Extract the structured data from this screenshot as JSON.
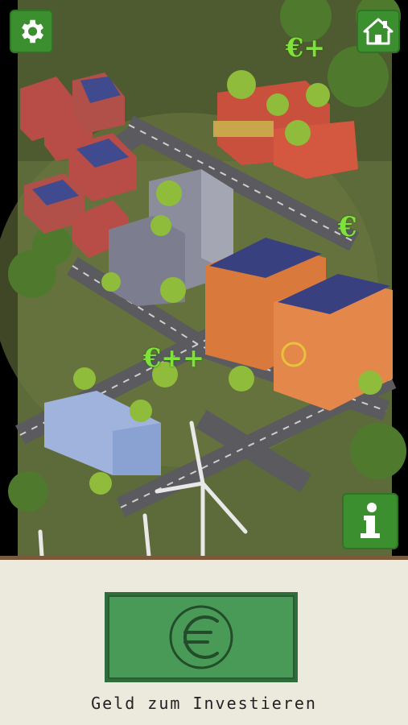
{
  "hud": {
    "settings_icon": "gear-icon",
    "home_icon": "house-icon",
    "info_icon": "info-icon",
    "button_color": "#3b8f2e"
  },
  "map": {
    "euro_indicators": [
      "€+",
      "€",
      "€++"
    ]
  },
  "bottom_panel": {
    "money_label": "Geld zum Investieren",
    "bill_icon": "euro-coin-icon",
    "bill_color": "#3e8f4e"
  }
}
